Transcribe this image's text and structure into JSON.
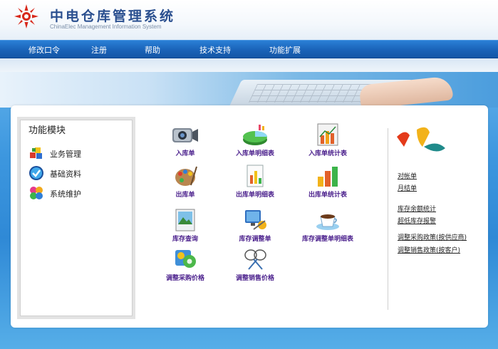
{
  "app": {
    "title": "中电仓库管理系统",
    "subtitle": "ChinaElec Management Information System"
  },
  "nav": {
    "items": [
      "修改口令",
      "注册",
      "帮助",
      "技术支持",
      "功能扩展"
    ]
  },
  "sidebar": {
    "title": "功能模块",
    "items": [
      {
        "label": "业务管理",
        "icon": "blocks-icon"
      },
      {
        "label": "基础资料",
        "icon": "checkmark-icon"
      },
      {
        "label": "系统维护",
        "icon": "puzzle-icon"
      }
    ]
  },
  "functions": [
    {
      "label": "入库单",
      "icon": "camcorder-icon"
    },
    {
      "label": "入库单明细表",
      "icon": "pie-chart-icon"
    },
    {
      "label": "入库单统计表",
      "icon": "bar-chart-icon"
    },
    {
      "label": "出库单",
      "icon": "palette-icon"
    },
    {
      "label": "出库单明细表",
      "icon": "document-chart-icon"
    },
    {
      "label": "出库单统计表",
      "icon": "bar-stats-icon"
    },
    {
      "label": "库存查询",
      "icon": "picture-icon"
    },
    {
      "label": "库存调整单",
      "icon": "monitor-tools-icon"
    },
    {
      "label": "库存调整单明细表",
      "icon": "coffee-cup-icon"
    },
    {
      "label": "调整采购价格",
      "icon": "gears-icon"
    },
    {
      "label": "调整销售价格",
      "icon": "badminton-icon"
    }
  ],
  "right_links": [
    "对帐单",
    "月结单",
    "库存余额统计",
    "超低库存报警",
    "调整采购政策(按供应商)",
    "调整销售政策(按客户)"
  ]
}
